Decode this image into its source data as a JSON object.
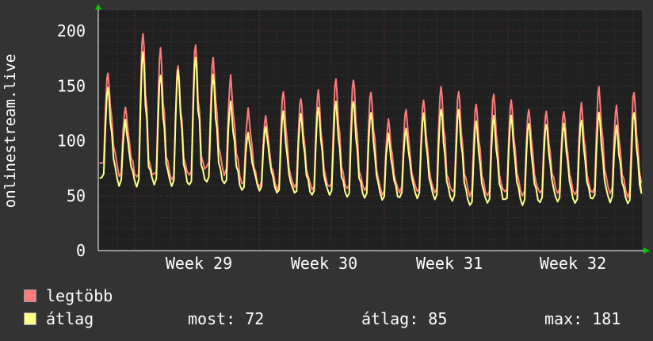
{
  "chart_data": {
    "type": "line",
    "ylabel": "onlinestream.live",
    "ylim": [
      0,
      220
    ],
    "y_ticks": [
      0,
      50,
      100,
      150,
      200
    ],
    "x_ticks": [
      "Week 29",
      "Week 30",
      "Week 31",
      "Week 32"
    ],
    "grid": true,
    "legend_placement": "bottom-left",
    "series": [
      {
        "name": "legtöbb",
        "color": "#ff7b7b",
        "daily_peaks": [
          138,
          163,
          132,
          198,
          183,
          170,
          188,
          176,
          158,
          128,
          124,
          145,
          140,
          145,
          155,
          157,
          146,
          118,
          128,
          138,
          150,
          146,
          135,
          142,
          137,
          130,
          128,
          128,
          133,
          148,
          132,
          145,
          135,
          140,
          144,
          135,
          145,
          115,
          150
        ],
        "daily_lows": [
          70,
          78,
          68,
          66,
          68,
          65,
          68,
          75,
          70,
          60,
          59,
          57,
          57,
          55,
          57,
          55,
          55,
          52,
          54,
          54,
          53,
          52,
          50,
          51,
          52,
          50,
          53,
          52,
          51,
          54,
          52,
          50,
          48,
          50,
          48,
          45,
          48,
          50,
          68
        ]
      },
      {
        "name": "átlag",
        "color": "#ffff88",
        "daily_peaks": [
          126,
          150,
          118,
          181,
          160,
          165,
          177,
          160,
          136,
          107,
          113,
          126,
          125,
          130,
          135,
          137,
          126,
          105,
          112,
          125,
          130,
          128,
          117,
          122,
          123,
          116,
          115,
          115,
          120,
          125,
          113,
          125,
          120,
          125,
          124,
          120,
          128,
          105,
          135
        ],
        "daily_lows": [
          62,
          65,
          60,
          60,
          62,
          60,
          60,
          62,
          60,
          55,
          55,
          52,
          52,
          50,
          51,
          49,
          49,
          46,
          48,
          47,
          46,
          45,
          42,
          44,
          45,
          43,
          45,
          45,
          44,
          46,
          44,
          42,
          40,
          41,
          40,
          37,
          40,
          42,
          58
        ]
      }
    ],
    "last_value": 75
  },
  "legend": {
    "max_label": "legtöbb",
    "avg_label": "átlag",
    "now_label": "most:",
    "now_value": "72",
    "avg_stat_label": "átlag:",
    "avg_stat_value": "85",
    "max_stat_label": "max:",
    "max_stat_value": "181",
    "max_color": "#ff7b7b",
    "avg_color": "#ffff88"
  }
}
